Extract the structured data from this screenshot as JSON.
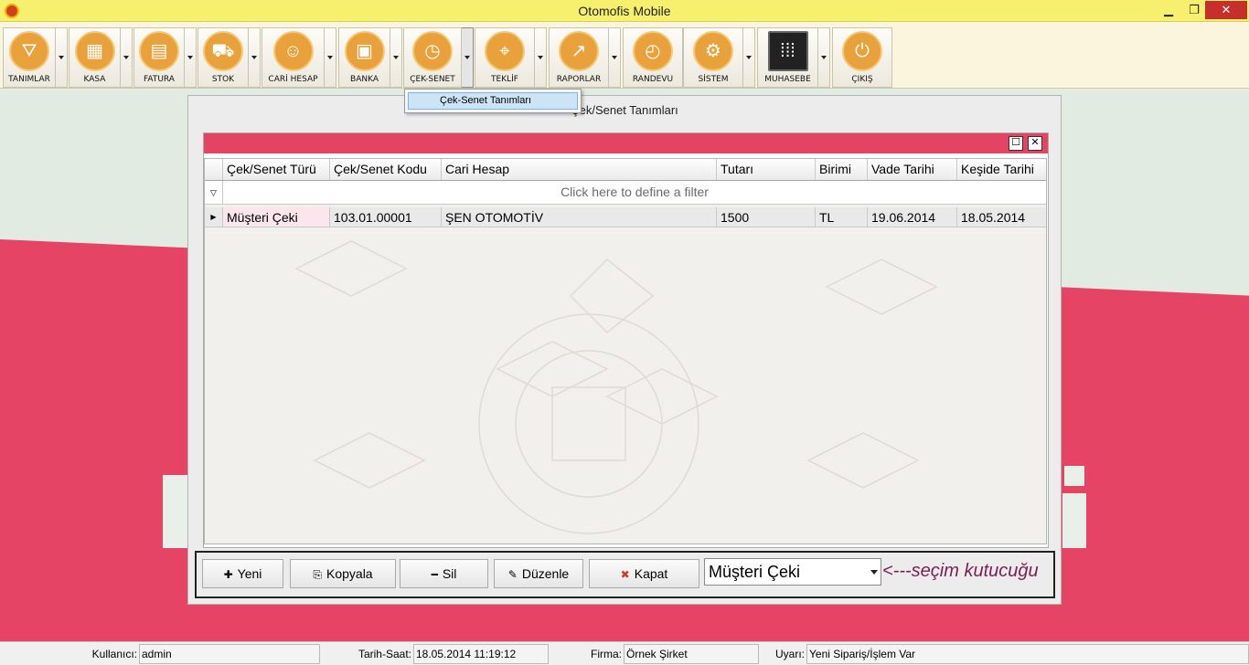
{
  "window": {
    "title": "Otomofis Mobile",
    "minimize": "▁",
    "maximize": "❐",
    "close": "✕"
  },
  "toolbar": {
    "buttons": [
      {
        "label": "TANIMLAR",
        "icon": "compass-icon"
      },
      {
        "label": "KASA",
        "icon": "calculator-icon"
      },
      {
        "label": "FATURA",
        "icon": "invoice-icon"
      },
      {
        "label": "STOK",
        "icon": "cart-icon"
      },
      {
        "label": "CARİ HESAP",
        "icon": "people-icon"
      },
      {
        "label": "BANKA",
        "icon": "wallet-icon"
      },
      {
        "label": "ÇEK-SENET",
        "icon": "alarm-clock-icon"
      },
      {
        "label": "TEKLİF",
        "icon": "map-pin-icon"
      },
      {
        "label": "RAPORLAR",
        "icon": "chart-icon"
      },
      {
        "label": "RANDEVU",
        "icon": "clock-icon"
      },
      {
        "label": "SİSTEM",
        "icon": "gear-icon"
      },
      {
        "label": "MUHASEBE",
        "icon": "abacus-icon"
      },
      {
        "label": "ÇIKIŞ",
        "icon": "power-icon"
      }
    ]
  },
  "dropdown": {
    "item": "Çek-Senet Tanımları"
  },
  "dialog": {
    "title": "Çek/Senet Tanımları",
    "maximize": "☐",
    "close": "✕",
    "columns": [
      "Çek/Senet Türü",
      "Çek/Senet Kodu",
      "Cari Hesap",
      "Tutarı",
      "Birimi",
      "Vade Tarihi",
      "Keşide Tarihi"
    ],
    "filter_text": "Click here to define a filter",
    "rows": [
      [
        "Müşteri Çeki",
        "103.01.00001",
        "ŞEN OTOMOTİV",
        "1500",
        "TL",
        "19.06.2014",
        "18.05.2014"
      ]
    ]
  },
  "actions": {
    "new": "Yeni",
    "copy": "Kopyala",
    "delete": "Sil",
    "edit": "Düzenle",
    "close": "Kapat",
    "combo_value": "Müşteri Çeki",
    "hint": "<---seçim kutucuğu"
  },
  "status": {
    "user_label": "Kullanıcı:",
    "user": "admin",
    "datetime_label": "Tarih-Saat:",
    "datetime": "18.05.2014 11:19:12",
    "company_label": "Firma:",
    "company": "Örnek Şirket",
    "warning_label": "Uyarı:",
    "warning": "Yeni Sipariş/İşlem Var"
  },
  "colors": {
    "accent_red": "#e34462",
    "title_yellow": "#f7ef6e",
    "icon_orange": "#e9a13b",
    "hint_purple": "#7b1d53"
  }
}
